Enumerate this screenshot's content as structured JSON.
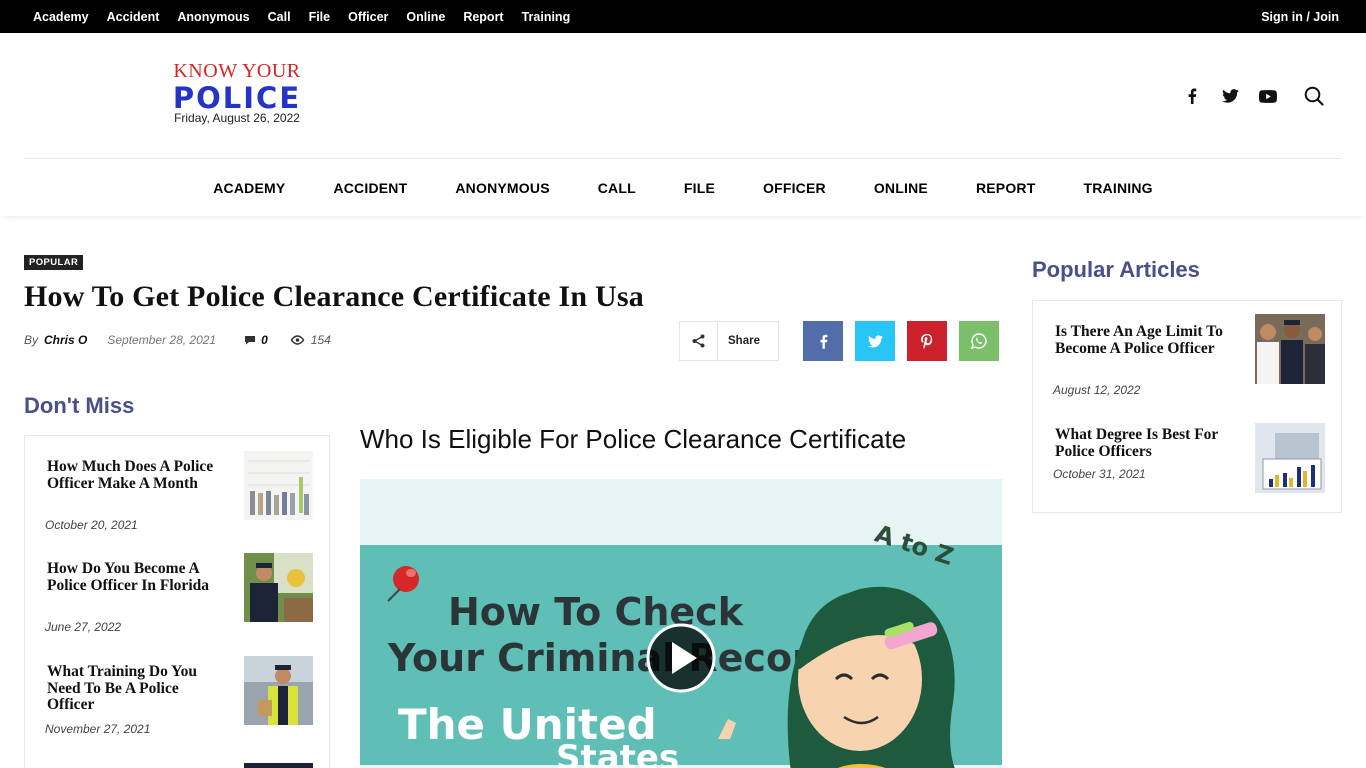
{
  "topbar": {
    "links": [
      "Academy",
      "Accident",
      "Anonymous",
      "Call",
      "File",
      "Officer",
      "Online",
      "Report",
      "Training"
    ],
    "signin": "Sign in / Join"
  },
  "logo": {
    "line1": "KNOW YOUR",
    "line2": "POLICE",
    "date": "Friday, August 26, 2022"
  },
  "social_icons": [
    "facebook-icon",
    "twitter-icon",
    "youtube-icon",
    "search-icon"
  ],
  "mainmenu": [
    "ACADEMY",
    "ACCIDENT",
    "ANONYMOUS",
    "CALL",
    "FILE",
    "OFFICER",
    "ONLINE",
    "REPORT",
    "TRAINING"
  ],
  "article": {
    "category": "POPULAR",
    "title": "How To Get Police Clearance Certificate In Usa",
    "by": "By",
    "author": "Chris O",
    "date": "September 28, 2021",
    "comments": "0",
    "views": "154",
    "share_label": "Share",
    "subheading": "Who Is Eligible For Police Clearance Certificate"
  },
  "colors": {
    "facebook": "#516eab",
    "twitter": "#29c5f6",
    "pinterest": "#ca212a",
    "whatsapp": "#7bbf6a",
    "section_title": "#4a4f8a",
    "logo_red": "#d92424",
    "logo_blue": "#2433c8"
  },
  "dont_miss": {
    "title": "Don't Miss",
    "items": [
      {
        "title": "How Much Does A Police Officer Make A Month",
        "date": "October 20, 2021"
      },
      {
        "title": "How Do You Become A Police Officer In Florida",
        "date": "June 27, 2022"
      },
      {
        "title": "What Training Do You Need To Be A Police Officer",
        "date": "November 27, 2021"
      }
    ]
  },
  "popular": {
    "title": "Popular Articles",
    "items": [
      {
        "title": "Is There An Age Limit To Become A Police Officer",
        "date": "August 12, 2022"
      },
      {
        "title": "What Degree Is Best For Police Officers",
        "date": "October 31, 2021"
      }
    ]
  },
  "video": {
    "line1": "How To Check",
    "line2": "Your Criminal Record",
    "line3": "The United",
    "line4": "States",
    "badge": "A to Z"
  }
}
